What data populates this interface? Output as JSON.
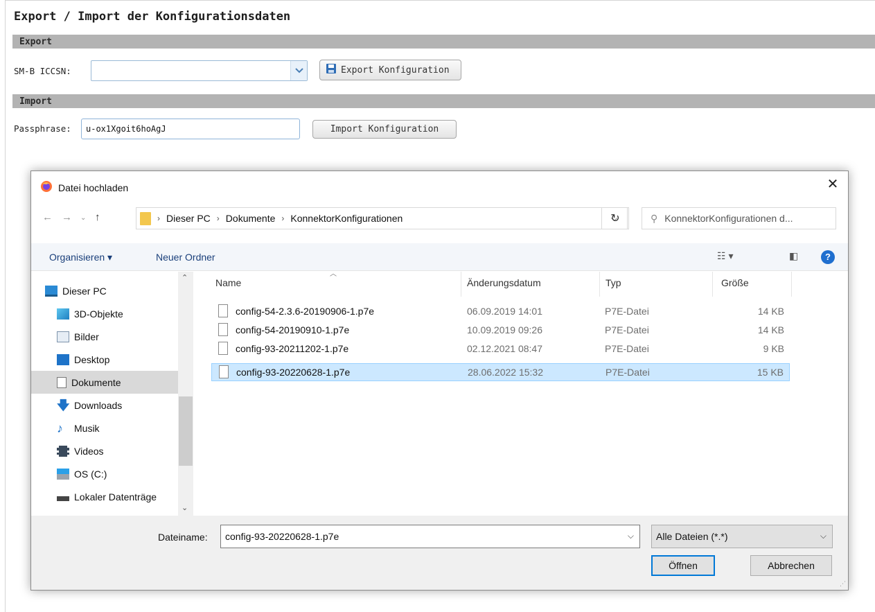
{
  "page": {
    "title": "Export / Import der Konfigurationsdaten",
    "export": {
      "section_title": "Export",
      "iccsn_label": "SM-B ICCSN:",
      "iccsn_value": "",
      "export_button": "Export Konfiguration"
    },
    "import": {
      "section_title": "Import",
      "passphrase_label": "Passphrase:",
      "passphrase_value": "u-ox1Xgoit6hoAgJ",
      "import_button": "Import Konfiguration"
    }
  },
  "dialog": {
    "title": "Datei hochladen",
    "close_glyph": "✕",
    "breadcrumb": [
      "Dieser PC",
      "Dokumente",
      "KonnektorKonfigurationen"
    ],
    "search_placeholder": "KonnektorKonfigurationen d...",
    "toolbar": {
      "organize": "Organisieren ▾",
      "new_folder": "Neuer Ordner",
      "help": "?"
    },
    "nav_items": [
      {
        "label": "Dieser PC",
        "icon": "computer-icon"
      },
      {
        "label": "3D-Objekte",
        "icon": "cube-icon"
      },
      {
        "label": "Bilder",
        "icon": "pictures-icon"
      },
      {
        "label": "Desktop",
        "icon": "desktop-icon"
      },
      {
        "label": "Dokumente",
        "icon": "documents-icon",
        "selected": true
      },
      {
        "label": "Downloads",
        "icon": "download-arrow-icon"
      },
      {
        "label": "Musik",
        "icon": "music-note-icon"
      },
      {
        "label": "Videos",
        "icon": "film-icon"
      },
      {
        "label": "OS (C:)",
        "icon": "os-drive-icon"
      },
      {
        "label": "Lokaler Datenträge",
        "icon": "drive-icon"
      }
    ],
    "columns": {
      "name": "Name",
      "date": "Änderungsdatum",
      "type": "Typ",
      "size": "Größe"
    },
    "files": [
      {
        "name": "config-54-2.3.6-20190906-1.p7e",
        "date": "06.09.2019 14:01",
        "type": "P7E-Datei",
        "size": "14 KB"
      },
      {
        "name": "config-54-20190910-1.p7e",
        "date": "10.09.2019 09:26",
        "type": "P7E-Datei",
        "size": "14 KB"
      },
      {
        "name": "config-93-20211202-1.p7e",
        "date": "02.12.2021 08:47",
        "type": "P7E-Datei",
        "size": "9 KB"
      },
      {
        "name": "config-93-20220628-1.p7e",
        "date": "28.06.2022 15:32",
        "type": "P7E-Datei",
        "size": "15 KB",
        "selected": true
      }
    ],
    "filename_label": "Dateiname:",
    "filename_value": "config-93-20220628-1.p7e",
    "filetype_value": "Alle Dateien (*.*)",
    "open_button": "Öffnen",
    "cancel_button": "Abbrechen",
    "colors": {
      "selection_bg": "#cce8ff",
      "selection_border": "#99d1ff",
      "default_button_border": "#0078d7",
      "help_icon": "#1f6fcf"
    }
  }
}
